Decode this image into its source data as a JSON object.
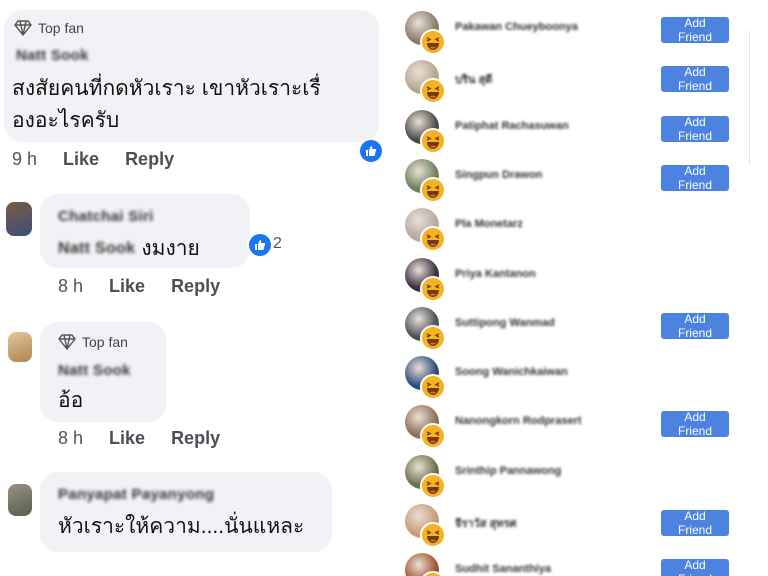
{
  "comments": [
    {
      "badge": "Top fan",
      "author": "Natt Sook",
      "text_line1": "สงสัยคนที่กดหัวเราะ เขาหัวเราะเรื่",
      "text_line2": "องอะไรครับ",
      "time": "9 h",
      "like": "Like",
      "reply": "Reply"
    },
    {
      "author": "Chatchai Siri",
      "mention": "Natt Sook",
      "text": "งมงาย",
      "reaction_count": "2",
      "time": "8 h",
      "like": "Like",
      "reply": "Reply"
    },
    {
      "badge": "Top fan",
      "author": "Natt Sook",
      "text": "อ้อ",
      "time": "8 h",
      "like": "Like",
      "reply": "Reply"
    },
    {
      "author": "Panyapat Payanyong",
      "text": "หัวเราะให้ความ....นั่นแหละ"
    }
  ],
  "reactors": [
    {
      "name": "Pakawan Chueyboonya",
      "button": "Add Friend",
      "avatar_color": "#8a7a6c"
    },
    {
      "name": "บริน สุดี",
      "button": "Add Friend",
      "avatar_color": "#b7a68f"
    },
    {
      "name": "Patiphat Rachasuwan",
      "button": "Add Friend",
      "avatar_color": "#4a4a48"
    },
    {
      "name": "Singpun Drawon",
      "button": "Add Friend",
      "avatar_color": "#6e7f5c"
    },
    {
      "name": "Pla Monetarz",
      "button": "",
      "avatar_color": "#b8a8a0"
    },
    {
      "name": "Priya Kantanon",
      "button": "",
      "avatar_color": "#3b2f3f"
    },
    {
      "name": "Suttipong Wanmad",
      "button": "Add Friend",
      "avatar_color": "#4d5058"
    },
    {
      "name": "Soong Wanichkaiwan",
      "button": "",
      "avatar_color": "#2e4a7c"
    },
    {
      "name": "Nanongkorn Rodprasert",
      "button": "Add Friend",
      "avatar_color": "#8c6f57"
    },
    {
      "name": "Srinthip Pannawong",
      "button": "",
      "avatar_color": "#6b7048"
    },
    {
      "name": "จีราวัส สุทรศ",
      "button": "Add Friend",
      "avatar_color": "#c79a72"
    },
    {
      "name": "Sudhit Sananthiya",
      "button": "Add Friend",
      "avatar_color": "#a0522d"
    }
  ]
}
